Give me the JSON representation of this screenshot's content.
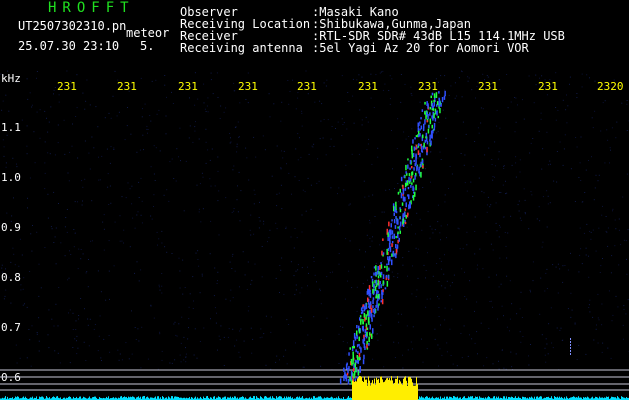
{
  "app_title": "HROFFT",
  "file": {
    "name": "UT2507302310.pn",
    "mode": "meteor",
    "timestamp": "25.07.30 23:10",
    "tick": "5."
  },
  "info": [
    {
      "label": "Observer",
      "value": ":Masaki Kano"
    },
    {
      "label": "Receiving Location",
      "value": ":Shibukawa,Gunma,Japan"
    },
    {
      "label": "Receiver",
      "value": ":RTL-SDR SDR# 43dB L15 114.1MHz USB"
    },
    {
      "label": "Receiving antenna",
      "value": ":5el Yagi Az 20 for Aomori VOR"
    }
  ],
  "axes": {
    "y_unit": "kHz",
    "y_ticks": [
      "1.1",
      "1.0",
      "0.9",
      "0.8",
      "0.7",
      "0.6"
    ],
    "x_ticks": [
      "231",
      "231",
      "231",
      "231",
      "231",
      "231",
      "231",
      "231",
      "231",
      "2320"
    ]
  },
  "colors": {
    "background": "#000000",
    "title": "#20e020",
    "tick_text": "#ffff00",
    "signal_blue": "#3050ff",
    "signal_green": "#20ff40",
    "signal_red": "#ff3030",
    "noise_floor": "#00e0ff",
    "noise_peak": "#ffee00"
  }
}
